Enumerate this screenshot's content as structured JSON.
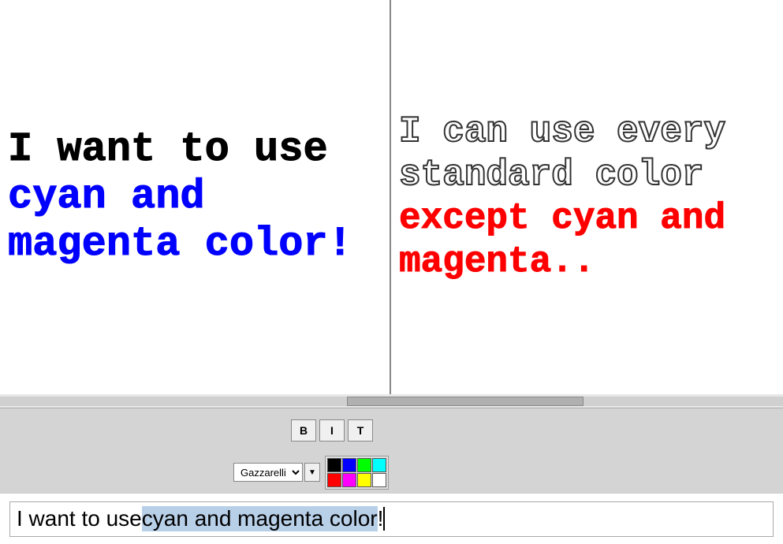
{
  "panels": {
    "left": {
      "line1": "I want to use",
      "line2": "cyan and",
      "line3": "magenta color!"
    },
    "right": {
      "line1": "I can use every",
      "line2": "standard color",
      "line3": "except cyan and",
      "line4": "magenta.."
    }
  },
  "toolbar": {
    "bold_label": "B",
    "italic_label": "I",
    "text_label": "T"
  },
  "font": {
    "name": "Gazzarelli",
    "dropdown_icon": "▼"
  },
  "colors": [
    {
      "name": "black",
      "hex": "#000000"
    },
    {
      "name": "blue",
      "hex": "#0000ff"
    },
    {
      "name": "green",
      "hex": "#00ff00"
    },
    {
      "name": "cyan",
      "hex": "#00ffff"
    },
    {
      "name": "red",
      "hex": "#ff0000"
    },
    {
      "name": "magenta",
      "hex": "#ff00ff"
    },
    {
      "name": "yellow",
      "hex": "#ffff00"
    },
    {
      "name": "white",
      "hex": "#ffffff"
    }
  ],
  "input": {
    "prefix": "I want  to use ",
    "selected": "cyan and magenta color",
    "suffix": "!"
  }
}
